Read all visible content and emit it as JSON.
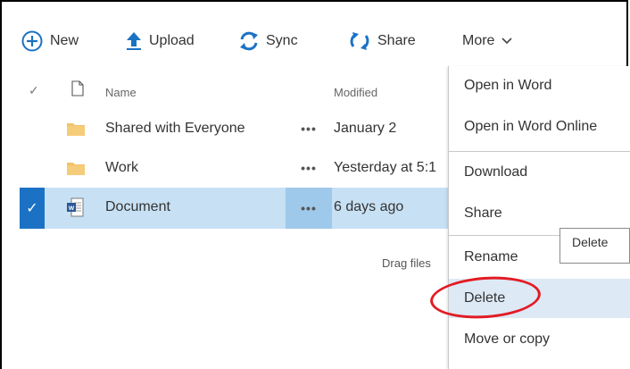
{
  "toolbar": {
    "new_label": "New",
    "upload_label": "Upload",
    "sync_label": "Sync",
    "share_label": "Share",
    "more_label": "More"
  },
  "header": {
    "name_label": "Name",
    "modified_label": "Modified"
  },
  "files": [
    {
      "name": "Shared with Everyone",
      "modified": "January 2",
      "type": "folder",
      "selected": false
    },
    {
      "name": "Work",
      "modified": "Yesterday at 5:1",
      "type": "folder",
      "selected": false
    },
    {
      "name": "Document",
      "modified": "6 days ago",
      "type": "word-document",
      "selected": true
    }
  ],
  "row_actions_label": "•••",
  "drag_hint": "Drag files",
  "menu": {
    "items": [
      {
        "label": "Open in Word"
      },
      {
        "label": "Open in Word Online"
      },
      {
        "label": "Download"
      },
      {
        "label": "Share"
      },
      {
        "label": "Rename"
      },
      {
        "label": "Delete",
        "highlighted": true
      },
      {
        "label": "Move or copy"
      }
    ]
  },
  "tooltip": {
    "text": "Delete"
  },
  "colors": {
    "accent_blue": "#1b72c4",
    "selected_row": "#c7e0f4",
    "menu_hover": "#dde9f5",
    "annotation_red": "#e31b23",
    "folder": "#f2c26b"
  },
  "icons": {
    "new": "plus-circle-icon",
    "upload": "upload-arrow-icon",
    "sync": "sync-icon",
    "share": "share-icon",
    "more": "chevron-down-icon",
    "folder": "folder-icon",
    "document": "word-document-icon"
  }
}
